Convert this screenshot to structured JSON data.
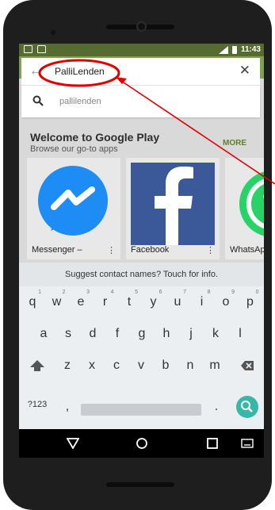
{
  "status_bar": {
    "time": "11:43"
  },
  "search": {
    "query": "PalliLenden"
  },
  "suggestion": {
    "text": "pallilenden"
  },
  "page": {
    "title": "Welcome to Google Play",
    "subtitle": "Browse our go-to apps",
    "more_label": "MORE",
    "apps": [
      {
        "name": "Messenger –",
        "icon": "messenger-icon",
        "color": "#1d8cf5"
      },
      {
        "name": "Facebook",
        "icon": "facebook-icon",
        "color": "#3b5998"
      },
      {
        "name": "WhatsApp",
        "icon": "whatsapp-icon",
        "color": "#25d366"
      }
    ]
  },
  "keyboard": {
    "hint": "Suggest contact names? Touch for info.",
    "row1": [
      "q",
      "w",
      "e",
      "r",
      "t",
      "y",
      "u",
      "i",
      "o",
      "p"
    ],
    "row1_numbers": [
      "1",
      "2",
      "3",
      "4",
      "5",
      "6",
      "7",
      "8",
      "9",
      "0"
    ],
    "row2": [
      "a",
      "s",
      "d",
      "f",
      "g",
      "h",
      "j",
      "k",
      "l"
    ],
    "row3": [
      "z",
      "x",
      "c",
      "v",
      "b",
      "n",
      "m"
    ],
    "symbols_label": "?123",
    "comma": ",",
    "period": "."
  },
  "colors": {
    "accent_green": "#7fa152",
    "status_bar": "#556b2f",
    "search_key": "#36b7a7",
    "annotation_red": "#e00000"
  }
}
